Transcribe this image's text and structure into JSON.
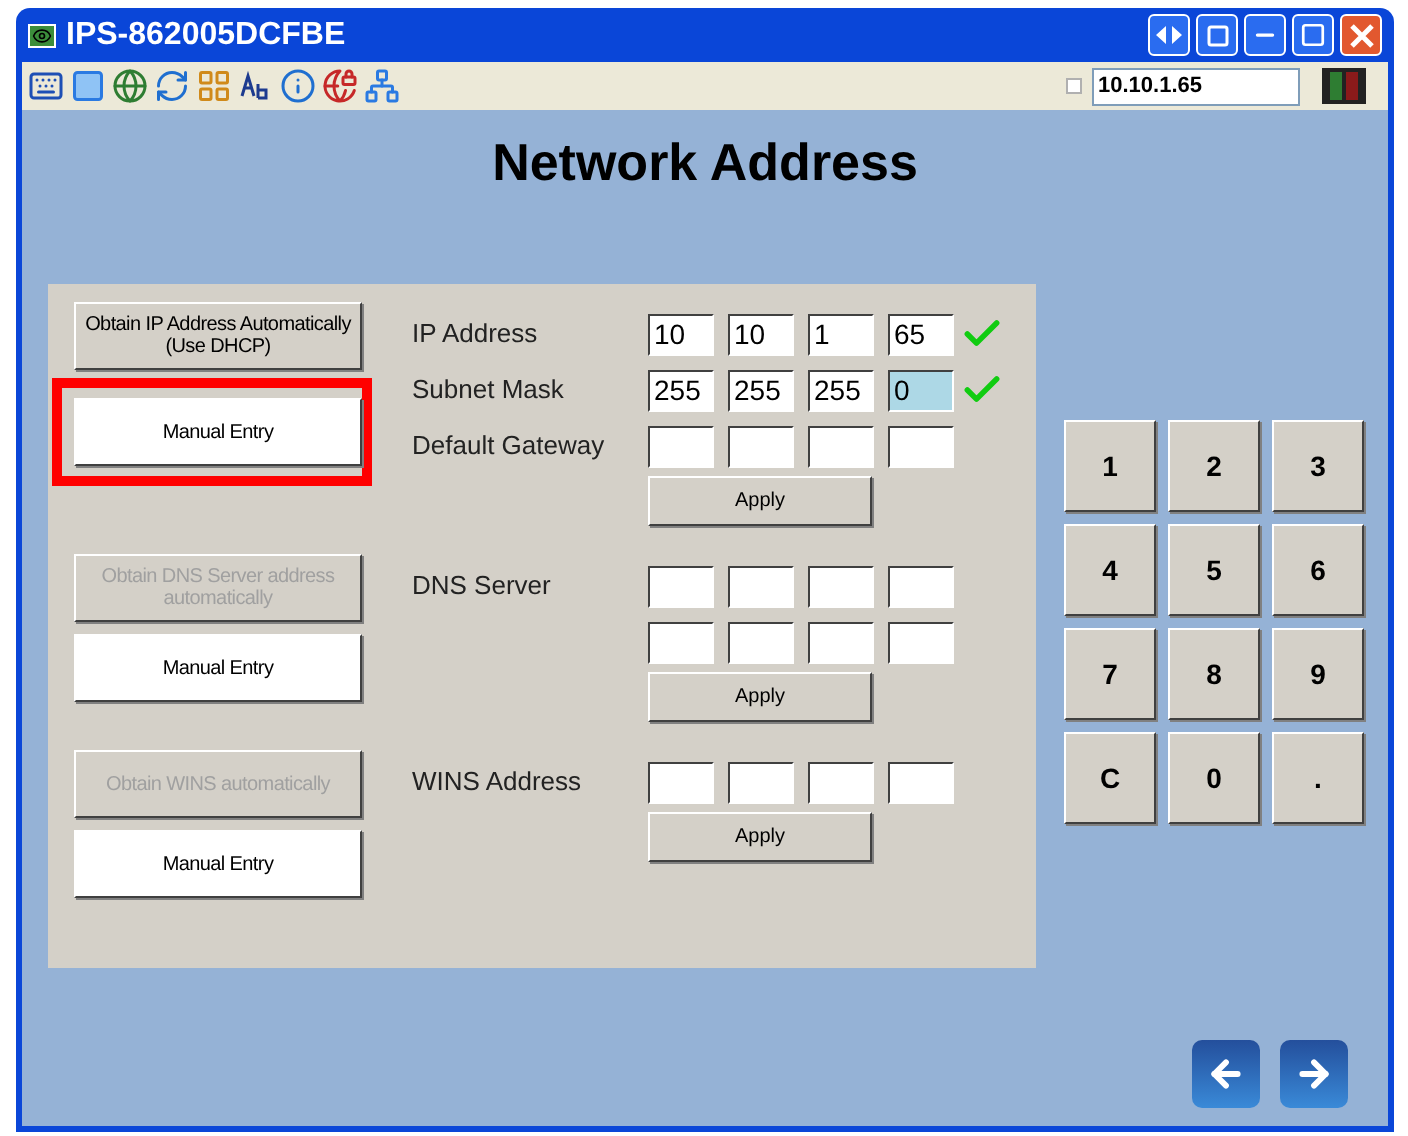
{
  "window": {
    "title": "IPS-862005DCFBE"
  },
  "toolbar": {
    "address": "10.10.1.65",
    "checkbox_checked": false
  },
  "heading": "Network Address",
  "sections": [
    {
      "buttons": [
        {
          "label": "Obtain IP Address Automatically (Use DHCP)",
          "kind": "auto",
          "disabled": false,
          "highlighted": false
        },
        {
          "label": "Manual Entry",
          "kind": "manual",
          "disabled": false,
          "highlighted": true
        }
      ],
      "rows": [
        {
          "label": "IP Address",
          "valid": true,
          "octets": [
            {
              "value": "10",
              "selected": false
            },
            {
              "value": "10",
              "selected": false
            },
            {
              "value": "1",
              "selected": false
            },
            {
              "value": "65",
              "selected": false
            }
          ]
        },
        {
          "label": "Subnet Mask",
          "valid": true,
          "octets": [
            {
              "value": "255",
              "selected": false
            },
            {
              "value": "255",
              "selected": false
            },
            {
              "value": "255",
              "selected": false
            },
            {
              "value": "0",
              "selected": true
            }
          ]
        },
        {
          "label": "Default Gateway",
          "valid": false,
          "octets": [
            {
              "selected": false
            },
            {
              "selected": false
            },
            {
              "selected": false
            },
            {
              "selected": false
            }
          ]
        }
      ],
      "apply": "Apply"
    },
    {
      "buttons": [
        {
          "label": "Obtain DNS Server address automatically",
          "kind": "auto",
          "disabled": true,
          "highlighted": false
        },
        {
          "label": "Manual Entry",
          "kind": "manual",
          "disabled": false,
          "highlighted": false
        }
      ],
      "rows": [
        {
          "label": "DNS Server",
          "valid": false,
          "octets": [
            {
              "selected": false
            },
            {
              "selected": false
            },
            {
              "selected": false
            },
            {
              "selected": false
            }
          ]
        },
        {
          "valid": false,
          "octets": [
            {
              "selected": false
            },
            {
              "selected": false
            },
            {
              "selected": false
            },
            {
              "selected": false
            }
          ]
        }
      ],
      "apply": "Apply"
    },
    {
      "buttons": [
        {
          "label": "Obtain WINS automatically",
          "kind": "auto",
          "disabled": true,
          "highlighted": false
        },
        {
          "label": "Manual Entry",
          "kind": "manual",
          "disabled": false,
          "highlighted": false
        }
      ],
      "rows": [
        {
          "label": "WINS Address",
          "valid": false,
          "octets": [
            {
              "selected": false
            },
            {
              "selected": false
            },
            {
              "selected": false
            },
            {
              "selected": false
            }
          ]
        }
      ],
      "apply": "Apply"
    }
  ],
  "keypad": [
    "1",
    "2",
    "3",
    "4",
    "5",
    "6",
    "7",
    "8",
    "9",
    "C",
    "0",
    "."
  ]
}
